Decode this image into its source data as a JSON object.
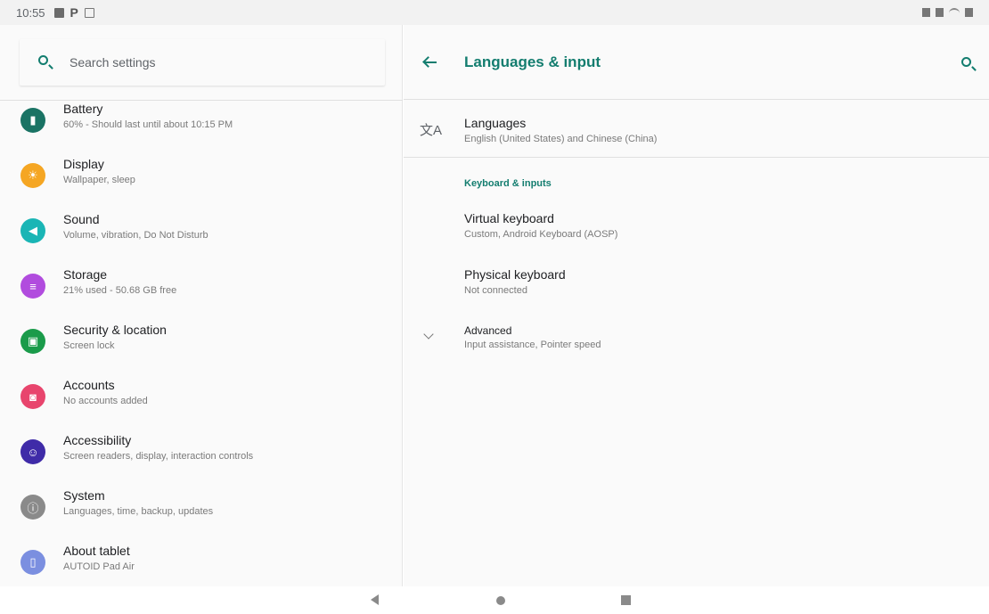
{
  "status_bar": {
    "time": "10:55"
  },
  "search": {
    "placeholder": "Search settings"
  },
  "settings": [
    {
      "title": "Battery",
      "subtitle": "60% - Should last until about 10:15 PM",
      "icon": "battery-icon",
      "color": "#1a7364"
    },
    {
      "title": "Display",
      "subtitle": "Wallpaper, sleep",
      "icon": "brightness-icon",
      "color": "#f5a623"
    },
    {
      "title": "Sound",
      "subtitle": "Volume, vibration, Do Not Disturb",
      "icon": "volume-icon",
      "color": "#1ab5b5"
    },
    {
      "title": "Storage",
      "subtitle": "21% used - 50.68 GB free",
      "icon": "storage-icon",
      "color": "#b14cde"
    },
    {
      "title": "Security & location",
      "subtitle": "Screen lock",
      "icon": "lock-icon",
      "color": "#1a9b4a"
    },
    {
      "title": "Accounts",
      "subtitle": "No accounts added",
      "icon": "account-icon",
      "color": "#e8456d"
    },
    {
      "title": "Accessibility",
      "subtitle": "Screen readers, display, interaction controls",
      "icon": "accessibility-icon",
      "color": "#3f2ba8"
    },
    {
      "title": "System",
      "subtitle": "Languages, time, backup, updates",
      "icon": "info-icon",
      "color": "#8a8a8a"
    },
    {
      "title": "About tablet",
      "subtitle": "AUTOID Pad Air",
      "icon": "tablet-icon",
      "color": "#7b8fe0"
    }
  ],
  "detail": {
    "title": "Languages & input",
    "languages": {
      "title": "Languages",
      "subtitle": "English (United States) and Chinese (China)"
    },
    "section_header": "Keyboard & inputs",
    "virtual_keyboard": {
      "title": "Virtual keyboard",
      "subtitle": "Custom, Android Keyboard (AOSP)"
    },
    "physical_keyboard": {
      "title": "Physical keyboard",
      "subtitle": "Not connected"
    },
    "advanced": {
      "title": "Advanced",
      "subtitle": "Input assistance, Pointer speed"
    }
  },
  "accent_color": "#137d6f"
}
